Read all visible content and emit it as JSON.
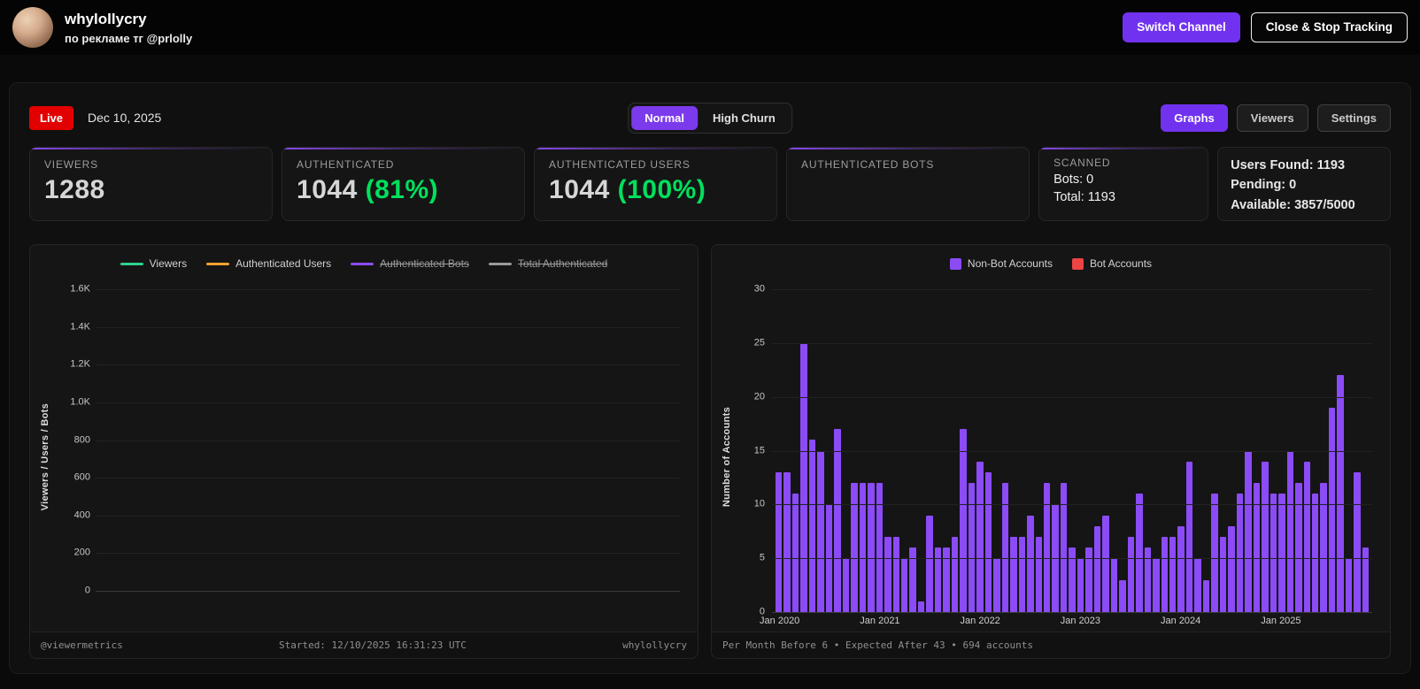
{
  "header": {
    "channel_name": "whylollycry",
    "channel_subtitle": "по рекламе тг @prlolly",
    "buttons": {
      "switch_channel": "Switch Channel",
      "close_stop": "Close & Stop Tracking"
    }
  },
  "toolbar": {
    "live_badge": "Live",
    "date": "Dec 10, 2025",
    "mode_toggle": {
      "normal": "Normal",
      "high_churn": "High Churn",
      "active": "Normal"
    },
    "views": {
      "graphs": "Graphs",
      "viewers": "Viewers",
      "settings": "Settings",
      "active": "Graphs"
    }
  },
  "stats": {
    "viewers": {
      "label": "VIEWERS",
      "value": "1288"
    },
    "authenticated": {
      "label": "AUTHENTICATED",
      "value": "1044",
      "percent": "(81%)"
    },
    "authenticated_users": {
      "label": "AUTHENTICATED USERS",
      "value": "1044",
      "percent": "(100%)"
    },
    "authenticated_bots": {
      "label": "AUTHENTICATED BOTS",
      "value": ""
    },
    "scanned": {
      "label": "SCANNED",
      "bots_line": "Bots: 0",
      "total_line": "Total: 1193"
    },
    "summary": {
      "users_found": "Users Found: 1193",
      "pending": "Pending: 0",
      "available": "Available: 3857/5000"
    }
  },
  "colors": {
    "accent_purple": "#7c3aed",
    "bar_purple": "#8b4bf6",
    "live_red": "#e30000",
    "percent_green": "#00e05d",
    "bot_red": "#ef4444",
    "viewers_green": "#2fd08c",
    "auth_users_orange": "#f0a030",
    "hidden_series_gray": "#9a9a9a"
  },
  "chart_data": [
    {
      "type": "line",
      "title": "",
      "ylabel": "Viewers / Users / Bots",
      "ylim": [
        0,
        1600
      ],
      "ytick_labels": [
        "1.6K",
        "1.4K",
        "1.2K",
        "1.0K",
        "800",
        "600",
        "400",
        "200",
        "0"
      ],
      "grid": true,
      "legend_position": "top",
      "series": [
        {
          "name": "Viewers",
          "color": "#2fd08c",
          "hidden": false,
          "values": []
        },
        {
          "name": "Authenticated Users",
          "color": "#f0a030",
          "hidden": false,
          "values": []
        },
        {
          "name": "Authenticated Bots",
          "color": "#8b4bf6",
          "hidden": true,
          "values": []
        },
        {
          "name": "Total Authenticated",
          "color": "#9a9a9a",
          "hidden": true,
          "values": []
        }
      ],
      "footer": {
        "left": "@viewermetrics",
        "center": "Started: 12/10/2025 16:31:23 UTC",
        "right": "whylollycry"
      }
    },
    {
      "type": "bar",
      "title": "",
      "ylabel": "Number of Accounts",
      "ylim": [
        0,
        30
      ],
      "ytick_labels": [
        "30",
        "25",
        "20",
        "15",
        "10",
        "5",
        "0"
      ],
      "x_unit": "month",
      "x_tick_labels": [
        "Jan 2020",
        "Jan 2021",
        "Jan 2022",
        "Jan 2023",
        "Jan 2024",
        "Jan 2025"
      ],
      "x_tick_every": 12,
      "legend_position": "top",
      "series": [
        {
          "name": "Non-Bot Accounts",
          "color": "#8b4bf6",
          "values": [
            13,
            13,
            11,
            25,
            16,
            15,
            10,
            17,
            5,
            12,
            12,
            12,
            12,
            7,
            7,
            5,
            6,
            1,
            9,
            6,
            6,
            7,
            17,
            12,
            14,
            13,
            5,
            12,
            7,
            7,
            9,
            7,
            12,
            10,
            12,
            6,
            5,
            6,
            8,
            9,
            5,
            3,
            7,
            11,
            6,
            5,
            7,
            7,
            8,
            14,
            5,
            3,
            11,
            7,
            8,
            11,
            15,
            12,
            14,
            11,
            11,
            15,
            12,
            14,
            11,
            12,
            19,
            22,
            5,
            13,
            6
          ]
        },
        {
          "name": "Bot Accounts",
          "color": "#ef4444",
          "values": []
        }
      ],
      "footer": "Per Month Before 6 • Expected After 43 • 694 accounts"
    }
  ]
}
